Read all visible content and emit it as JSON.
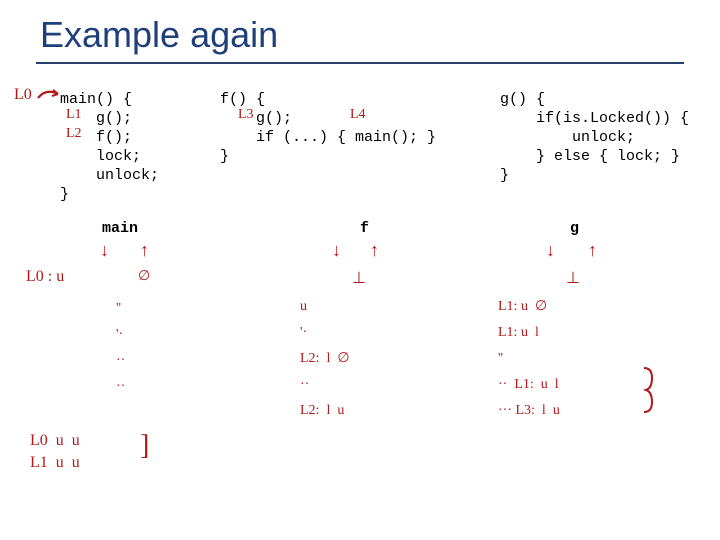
{
  "title": "Example again",
  "code": {
    "main": "main() {\n    g();\n    f();\n    lock;\n    unlock;\n}",
    "f": "f() {\n    g();\n    if (...) { main(); }\n}",
    "g": "g() {\n    if(is.Locked()) {\n        unlock;\n    } else { lock; }\n}"
  },
  "columns": {
    "main": "main",
    "f": "f",
    "g": "g"
  },
  "hand": {
    "L0_leader": "L0",
    "L1_in_main": "L1",
    "L2_in_main": "L2",
    "L3_in_f": "L3",
    "L4_in_f": "L4",
    "main_row_L0": "L0 : u",
    "main_col_dots": "''\n'·\n··\n··",
    "main_bottom_L0": "L0  u  u",
    "main_bottom_L1": "L1  u  u",
    "f_head": "⊥",
    "f_rows": "u\n'·\nL2:  l  ∅\n··\nL2:  l  u",
    "g_head": "⊥",
    "g_rows": "L1: u  ∅\nL1: u  l\n''\n··  L1:  u  l\n··· L3:  l  u",
    "arrows_down": "↓",
    "arrows_up": "↑",
    "zero_mark": "∅",
    "bracket": "]"
  }
}
